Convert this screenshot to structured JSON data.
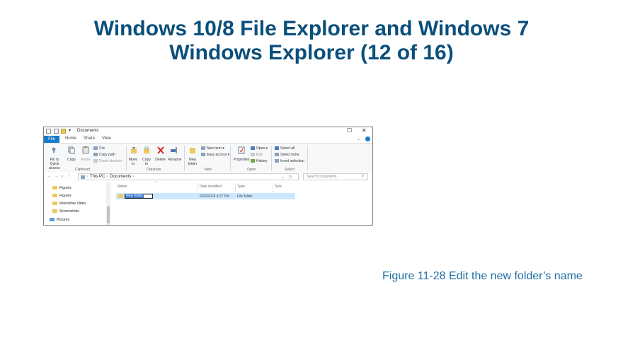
{
  "slide": {
    "title_line1": "Windows 10/8 File Explorer and Windows 7",
    "title_line2": "Windows Explorer (12 of 16)",
    "caption": "Figure 11-28  Edit the new folder’s name"
  },
  "window": {
    "title": "Documents",
    "controls": {
      "maximize": "☐",
      "close": "✕"
    }
  },
  "tabs": [
    "File",
    "Home",
    "Share",
    "View"
  ],
  "ribbon": {
    "clipboard": {
      "pin": "Pin to Quick access",
      "copy": "Copy",
      "paste": "Paste",
      "cut": "Cut",
      "copy_path": "Copy path",
      "paste_shortcut": "Paste shortcut",
      "group": "Clipboard"
    },
    "organize": {
      "move_to": "Move to",
      "copy_to": "Copy to",
      "delete": "Delete",
      "rename": "Rename",
      "group": "Organize"
    },
    "new": {
      "new_folder": "New folder",
      "new_item": "New item ▾",
      "easy_access": "Easy access ▾",
      "group": "New"
    },
    "open": {
      "properties": "Properties",
      "open": "Open ▾",
      "edit": "Edit",
      "history": "History",
      "group": "Open"
    },
    "select": {
      "select_all": "Select all",
      "select_none": "Select none",
      "invert": "Invert selection",
      "group": "Select"
    }
  },
  "address": {
    "breadcrumb_1": "This PC",
    "breadcrumb_2": "Documents",
    "search_placeholder": "Search Documents"
  },
  "nav_pane": {
    "items": [
      "Figures",
      "Figures",
      "Interactive Video",
      "Screenshots",
      "Pictures"
    ]
  },
  "columns": {
    "name": "Name",
    "date": "Date modified",
    "type": "Type",
    "size": "Size"
  },
  "row": {
    "name": "New folder",
    "date": "6/30/2018 4:27 PM",
    "type": "File folder"
  },
  "colors": {
    "title": "#0b4f7c",
    "caption": "#1f6fa3",
    "file_tab": "#1979ca",
    "row_selected": "#cce8ff",
    "folder": "#f0c75e"
  }
}
